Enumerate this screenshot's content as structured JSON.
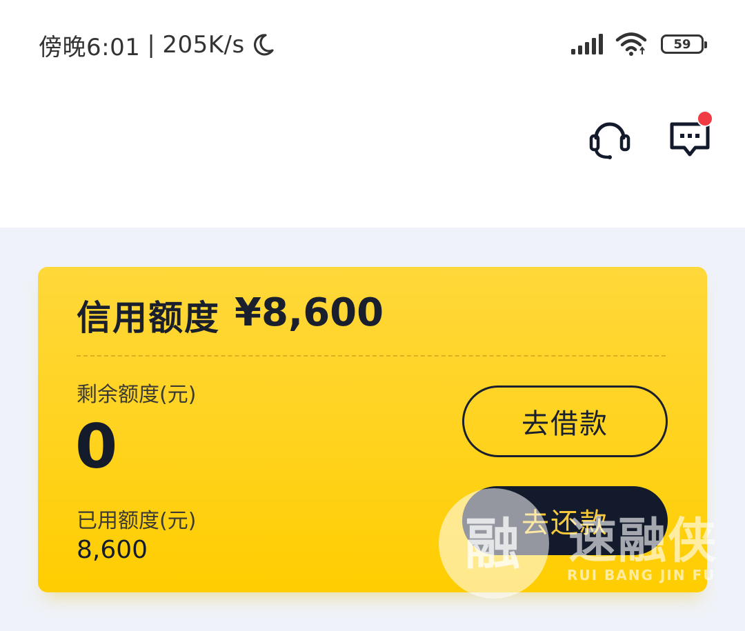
{
  "status_bar": {
    "time": "傍晚6:01",
    "separator": "|",
    "network_speed": "205K/s",
    "battery": "59",
    "icons": [
      "moon-icon",
      "signal-icon",
      "wifi-icon",
      "battery-icon"
    ]
  },
  "header": {
    "icons": [
      "headset-icon",
      "message-icon"
    ],
    "notification_color": "#ef3b43"
  },
  "card": {
    "credit_label": "信用额度",
    "credit_value": "¥8,600",
    "remaining_label": "剩余额度(元)",
    "remaining_value": "0",
    "used_label": "已用额度(元)",
    "used_value": "8,600",
    "borrow_label": "去借款",
    "repay_label": "去还款",
    "card_color": "#ffd21a",
    "repay_button_color": "#121a2c",
    "repay_text_color": "#f6c93a"
  },
  "watermark": {
    "mark": "融",
    "name": "速融侠",
    "pinyin": "RUI BANG JIN FU"
  }
}
